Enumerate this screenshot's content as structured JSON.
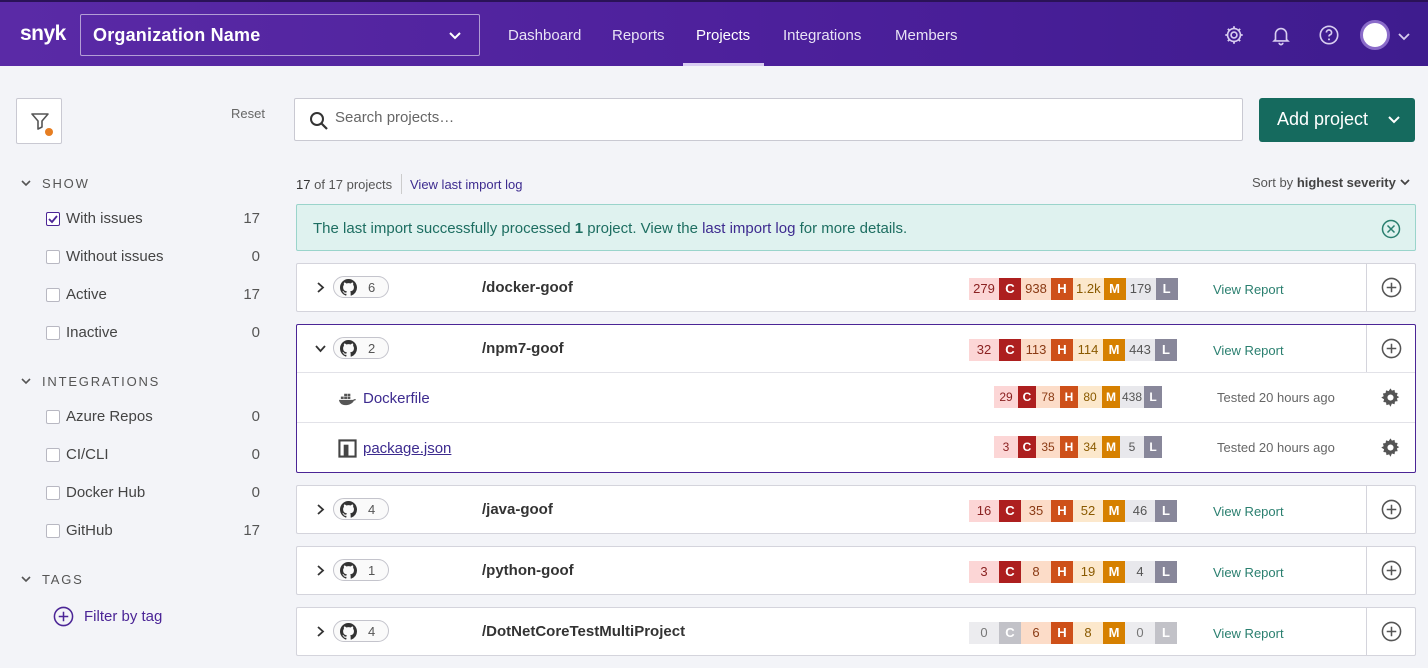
{
  "header": {
    "logo": "snyk",
    "org_name": "Organization Name",
    "nav": [
      "Dashboard",
      "Reports",
      "Projects",
      "Integrations",
      "Members"
    ],
    "active_nav": "Projects"
  },
  "sidebar": {
    "reset": "Reset",
    "show": {
      "title": "SHOW",
      "items": [
        {
          "label": "With issues",
          "count": "17",
          "checked": true
        },
        {
          "label": "Without issues",
          "count": "0",
          "checked": false
        },
        {
          "label": "Active",
          "count": "17",
          "checked": false
        },
        {
          "label": "Inactive",
          "count": "0",
          "checked": false
        }
      ]
    },
    "integrations": {
      "title": "INTEGRATIONS",
      "items": [
        {
          "label": "Azure Repos",
          "count": "0"
        },
        {
          "label": "CI/CLI",
          "count": "0"
        },
        {
          "label": "Docker Hub",
          "count": "0"
        },
        {
          "label": "GitHub",
          "count": "17"
        }
      ]
    },
    "tags": {
      "title": "TAGS",
      "filter_label": "Filter by tag"
    }
  },
  "main": {
    "search_placeholder": "Search projects…",
    "add_project": "Add project",
    "count_shown": "17",
    "count_of": "of 17 projects",
    "view_import_log": "View last import log",
    "sort_prefix": "Sort by",
    "sort_value": "highest severity",
    "banner": {
      "pre": "The last import successfully processed ",
      "count": "1",
      "mid": " project. View the ",
      "link": "last import log",
      "post": " for more details."
    },
    "view_report": "View Report",
    "projects": [
      {
        "name": "/docker-goof",
        "count": "6",
        "sev": [
          "279",
          "938",
          "1.2k",
          "179"
        ]
      },
      {
        "name": "/npm7-goof",
        "count": "2",
        "sev": [
          "32",
          "113",
          "114",
          "443"
        ],
        "targets": [
          {
            "name": "Dockerfile",
            "sev": [
              "29",
              "78",
              "80",
              "438"
            ],
            "tested": "Tested 20 hours ago"
          },
          {
            "name": "package.json",
            "sev": [
              "3",
              "35",
              "34",
              "5"
            ],
            "tested": "Tested 20 hours ago"
          }
        ]
      },
      {
        "name": "/java-goof",
        "count": "4",
        "sev": [
          "16",
          "35",
          "52",
          "46"
        ]
      },
      {
        "name": "/python-goof",
        "count": "1",
        "sev": [
          "3",
          "8",
          "19",
          "4"
        ]
      },
      {
        "name": "/DotNetCoreTestMultiProject",
        "count": "4",
        "sev": [
          "0",
          "6",
          "8",
          "0"
        ]
      }
    ],
    "severity_letters": [
      "C",
      "H",
      "M",
      "L"
    ]
  },
  "colors": {
    "header": "#4b1f9a",
    "accent": "#156a5e",
    "critical": "#ad1f1f",
    "high": "#ce5019",
    "medium": "#d68000",
    "low": "#88879a"
  }
}
